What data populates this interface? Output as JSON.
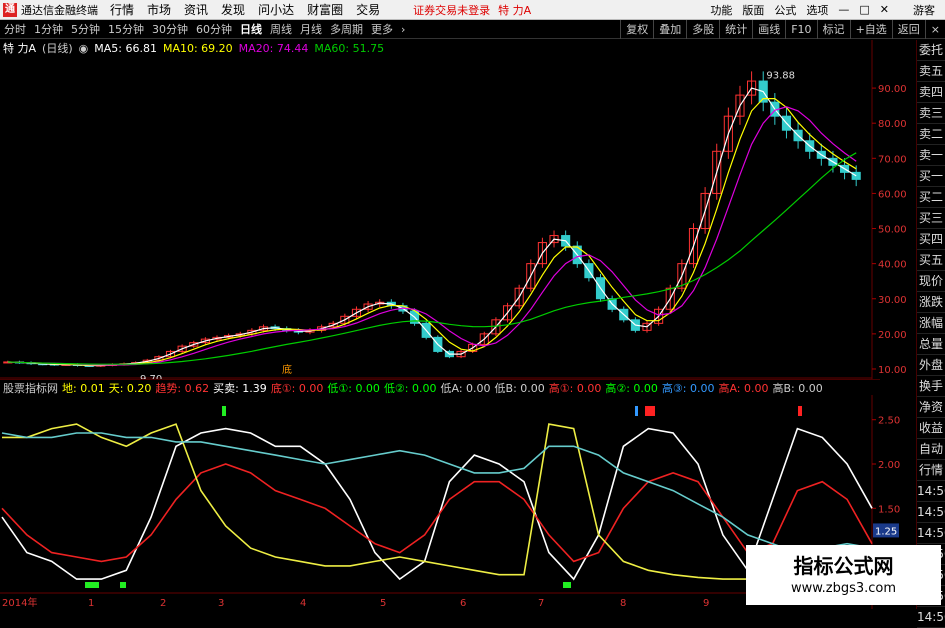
{
  "app": {
    "title": "通达信金融终端",
    "menus": [
      "行情",
      "市场",
      "资讯",
      "发现",
      "问小达",
      "财富圈",
      "交易"
    ],
    "login_status": "证券交易未登录",
    "stock_name": "特 力A",
    "right_items": [
      "功能",
      "版面",
      "公式",
      "选项"
    ],
    "guest": "游客"
  },
  "periods": {
    "items": [
      "分时",
      "1分钟",
      "5分钟",
      "15分钟",
      "30分钟",
      "60分钟",
      "日线",
      "周线",
      "月线",
      "多周期",
      "更多"
    ],
    "active": "日线"
  },
  "toolbar": [
    "复权",
    "叠加",
    "多股",
    "统计",
    "画线",
    "F10",
    "标记",
    "+自选",
    "返回"
  ],
  "ma_info": {
    "stock": "特 力A",
    "period": "(日线)",
    "ma5": "MA5: 66.81",
    "ma10": "MA10: 69.20",
    "ma20": "MA20: 74.44",
    "ma60": "MA60: 51.75"
  },
  "indicator_info": [
    {
      "text": "股票指标网",
      "color": "#ccc"
    },
    {
      "text": "地: 0.01",
      "color": "#ff0"
    },
    {
      "text": "天: 0.20",
      "color": "#ff0"
    },
    {
      "text": "趋势: 0.62",
      "color": "#f33"
    },
    {
      "text": "买卖: 1.39",
      "color": "#fff"
    },
    {
      "text": "底①: 0.00",
      "color": "#f33"
    },
    {
      "text": "低①: 0.00",
      "color": "#0f0"
    },
    {
      "text": "低②: 0.00",
      "color": "#0f0"
    },
    {
      "text": "低A: 0.00",
      "color": "#ccc"
    },
    {
      "text": "低B: 0.00",
      "color": "#ccc"
    },
    {
      "text": "高①: 0.00",
      "color": "#f33"
    },
    {
      "text": "高②: 0.00",
      "color": "#0f0"
    },
    {
      "text": "高③: 0.00",
      "color": "#39f"
    },
    {
      "text": "高A: 0.00",
      "color": "#f33"
    },
    {
      "text": "高B: 0.00",
      "color": "#ccc"
    }
  ],
  "sidebar": [
    "委托",
    "卖五",
    "卖四",
    "卖三",
    "卖二",
    "卖一",
    "买一",
    "买二",
    "买三",
    "买四",
    "买五",
    "现价",
    "涨跌",
    "涨幅",
    "总量",
    "外盘",
    "换手",
    "净资",
    "收益",
    "自动",
    "行情",
    "14:50",
    "14:50",
    "14:50",
    "14:50",
    "14:50",
    "14:50",
    "14:50"
  ],
  "chart_data": [
    {
      "type": "candlestick",
      "ylim": [
        8,
        98
      ],
      "yticks": [
        "90.00",
        "80.00",
        "70.00",
        "60.00",
        "50.00",
        "40.00",
        "30.00",
        "20.00",
        "10.00"
      ],
      "annotations": [
        "93.88",
        "9.70",
        "底"
      ],
      "series": [
        {
          "name": "MA5",
          "color": "#fff"
        },
        {
          "name": "MA10",
          "color": "#ff0"
        },
        {
          "name": "MA20",
          "color": "#d0d"
        },
        {
          "name": "MA60",
          "color": "#0c0"
        }
      ],
      "close": [
        12.0,
        11.8,
        11.5,
        11.4,
        11.2,
        11.3,
        11.0,
        10.9,
        11.1,
        11.3,
        11.5,
        11.8,
        12.5,
        13.5,
        15.0,
        16.5,
        17.5,
        18.5,
        19.0,
        19.5,
        20.0,
        21.0,
        22.0,
        21.5,
        21.0,
        20.5,
        21.0,
        22.0,
        23.0,
        25.0,
        27.0,
        28.5,
        29.0,
        28.0,
        26.5,
        23.0,
        19.0,
        15.0,
        13.5,
        15.0,
        17.0,
        20.0,
        24.0,
        28.0,
        33.0,
        40.0,
        46.0,
        48.0,
        45.0,
        40.0,
        36.0,
        30.0,
        27.0,
        24.0,
        21.0,
        23.0,
        27.0,
        33.0,
        40.0,
        50.0,
        60.0,
        72.0,
        82.0,
        88.0,
        92.0,
        86.0,
        82.0,
        78.0,
        75.0,
        72.0,
        70.0,
        68.0,
        66.0,
        64.0
      ]
    },
    {
      "type": "line",
      "ylim": [
        0.6,
        2.7
      ],
      "yticks": [
        "2.50",
        "2.00",
        "1.50",
        "1.00"
      ],
      "current_value": "1.25",
      "xlabels": [
        "2014年",
        "1",
        "2",
        "3",
        "4",
        "5",
        "6",
        "7",
        "8",
        "9"
      ],
      "series": [
        {
          "name": "买卖",
          "color": "#fff",
          "values": [
            1.4,
            1.0,
            0.9,
            0.7,
            0.7,
            0.8,
            1.4,
            2.2,
            2.35,
            2.4,
            2.35,
            2.2,
            2.2,
            2.0,
            1.6,
            1.0,
            0.7,
            0.9,
            1.8,
            2.1,
            2.0,
            1.8,
            1.0,
            0.7,
            1.2,
            2.2,
            2.4,
            2.35,
            2.0,
            1.2,
            0.8,
            1.6,
            2.4,
            2.3,
            2.0,
            1.5
          ]
        },
        {
          "name": "趋势",
          "color": "#e22",
          "values": [
            1.5,
            1.2,
            1.0,
            0.95,
            0.9,
            0.95,
            1.2,
            1.6,
            1.9,
            2.0,
            1.9,
            1.7,
            1.6,
            1.5,
            1.3,
            1.1,
            1.0,
            1.2,
            1.6,
            1.8,
            1.8,
            1.6,
            1.2,
            0.9,
            1.0,
            1.5,
            1.8,
            1.9,
            1.8,
            1.4,
            1.0,
            1.1,
            1.7,
            1.8,
            1.6,
            1.1
          ]
        },
        {
          "name": "天",
          "color": "#ee4",
          "values": [
            2.3,
            2.3,
            2.4,
            2.45,
            2.3,
            2.2,
            2.35,
            2.45,
            1.7,
            1.3,
            1.05,
            0.95,
            0.9,
            0.85,
            0.85,
            0.9,
            0.95,
            0.9,
            0.85,
            0.8,
            0.75,
            0.75,
            2.45,
            2.4,
            1.2,
            0.9,
            0.8,
            0.75,
            0.72,
            0.7,
            0.7,
            0.7,
            0.7,
            0.7,
            0.7,
            0.7
          ]
        },
        {
          "name": "地",
          "color": "#6cc",
          "values": [
            2.35,
            2.3,
            2.3,
            2.35,
            2.35,
            2.3,
            2.3,
            2.25,
            2.25,
            2.2,
            2.15,
            2.1,
            2.05,
            2.0,
            2.05,
            2.1,
            2.15,
            2.1,
            2.0,
            1.9,
            1.9,
            1.95,
            2.2,
            2.2,
            2.1,
            1.9,
            1.8,
            1.7,
            1.55,
            1.4,
            1.2,
            1.1,
            1.0,
            1.05,
            1.1,
            1.05
          ]
        }
      ]
    }
  ]
}
